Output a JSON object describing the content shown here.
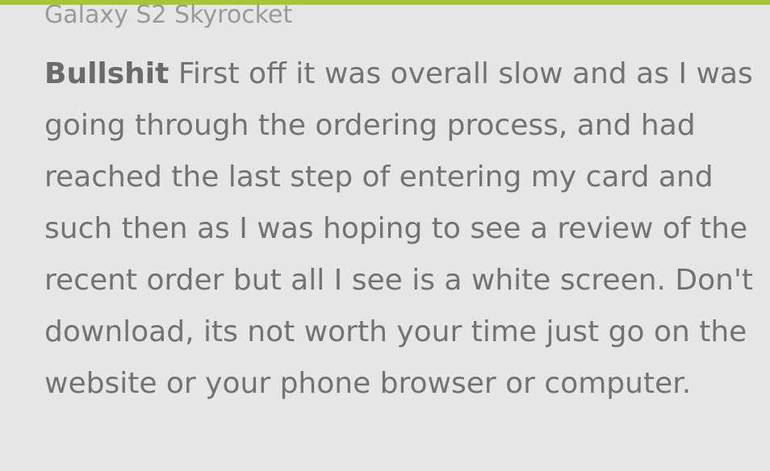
{
  "colors": {
    "accent": "#a4c639",
    "background": "#e6e6e6",
    "text": "#737373",
    "muted_text": "#9a9a9a"
  },
  "review": {
    "device": "Galaxy S2 Skyrocket",
    "title": "Bullshit",
    "text": "First off it was overall slow and as I was going through the ordering process, and had reached the last step of entering my card and such then as I was hoping to see a review of the recent order but all I see is a white screen. Don't download, its not worth your time just go on the website or your phone browser or computer."
  }
}
